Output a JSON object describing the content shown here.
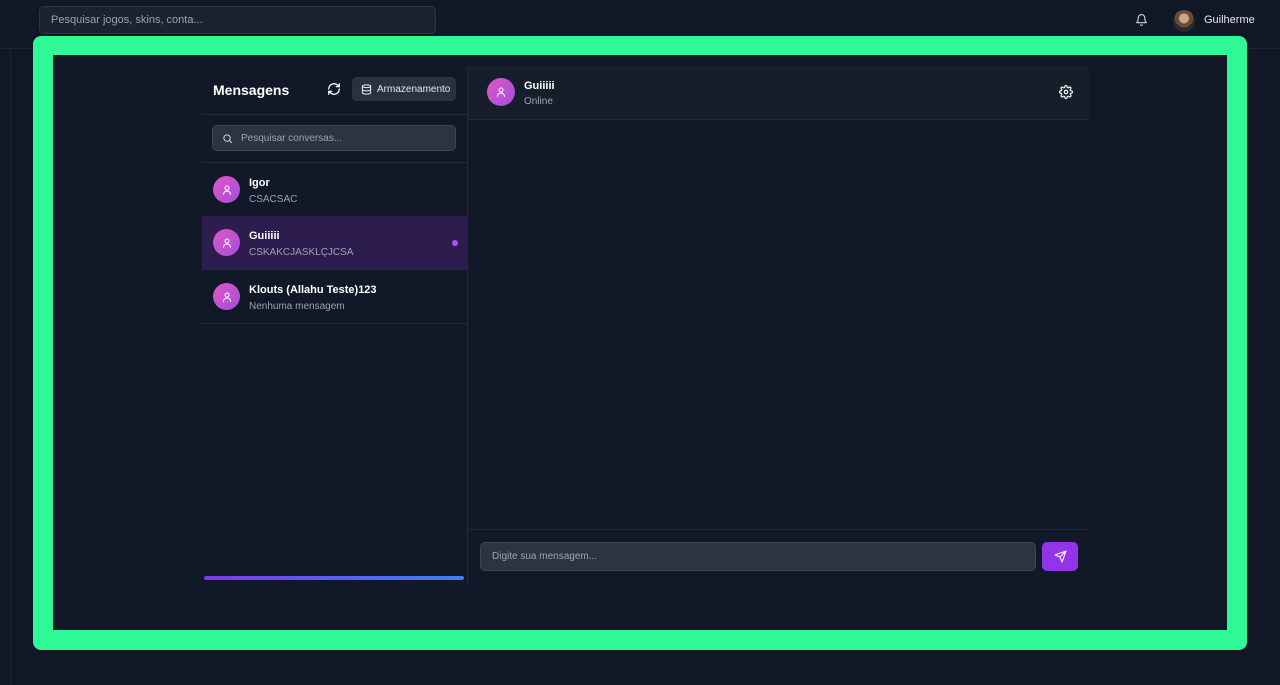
{
  "topbar": {
    "search_placeholder": "Pesquisar jogos, skins, conta...",
    "user_name": "Guilherme",
    "bell_icon": "bell-icon"
  },
  "sidebar": {
    "title": "Mensagens",
    "refresh_icon": "refresh-icon",
    "storage_label": "Armazenamento",
    "storage_icon": "database-icon",
    "search_placeholder": "Pesquisar conversas...",
    "conversations": [
      {
        "name": "Igor",
        "preview": "CSACSAC",
        "active": false,
        "unread": false
      },
      {
        "name": "Guiiiii",
        "preview": "CSKAKCJASKLÇJCSA",
        "active": true,
        "unread": true
      },
      {
        "name": "Klouts (Allahu Teste)123",
        "preview": "Nenhuma mensagem",
        "active": false,
        "unread": false
      }
    ],
    "storage_progress": 1.0
  },
  "chat": {
    "contact_name": "Guiiiii",
    "contact_status": "Online",
    "settings_icon": "gear-icon",
    "input_placeholder": "Digite sua mensagem...",
    "send_icon": "send-icon"
  },
  "colors": {
    "frame": "#2ff996",
    "background": "#111827",
    "accent": "#9333ea",
    "active_row": "#2c1d4e",
    "avatar_gradient_start": "#e056c6",
    "avatar_gradient_end": "#a24fdc"
  }
}
